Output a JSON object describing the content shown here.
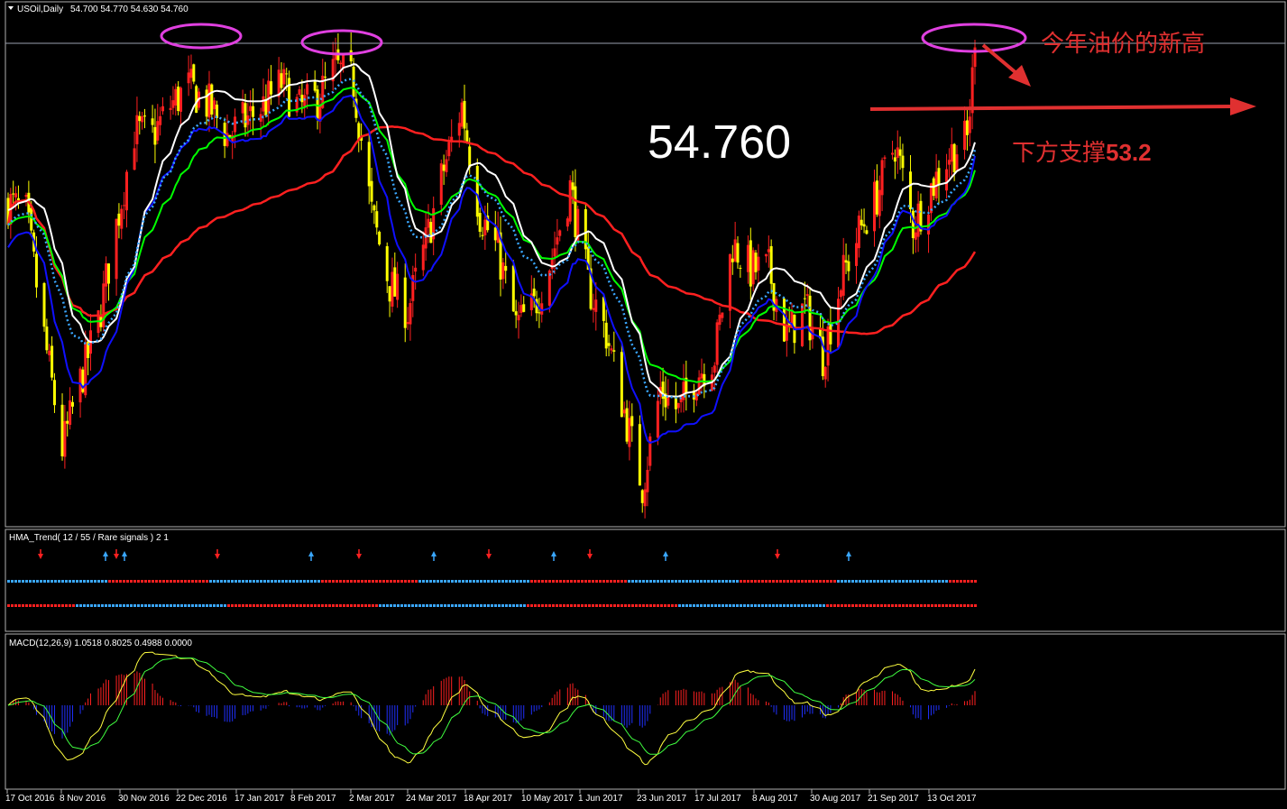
{
  "header": {
    "symbol": "USOil,Daily",
    "ohlc": "54.700 54.770 54.630 54.760"
  },
  "annotations": {
    "price_big": "54.760",
    "new_high": "今年油价的新高",
    "support_prefix": "下方支撑",
    "support_value": "53.2"
  },
  "hma_panel": {
    "title": "HMA_Trend( 12 / 55 / Rare signals ) 2 1",
    "signals": [
      {
        "x": "Oct 2016",
        "dir": "down"
      },
      {
        "x": "Nov 2016 a",
        "dir": "up"
      },
      {
        "x": "Nov 2016 b",
        "dir": "down"
      },
      {
        "x": "Nov 2016 c",
        "dir": "up"
      },
      {
        "x": "Dec 2016",
        "dir": "down"
      },
      {
        "x": "Feb 2017 a",
        "dir": "up"
      },
      {
        "x": "Feb 2017 b",
        "dir": "down"
      },
      {
        "x": "Mar 2017",
        "dir": "up"
      },
      {
        "x": "Apr 2017",
        "dir": "down"
      },
      {
        "x": "May 2017 a",
        "dir": "up"
      },
      {
        "x": "May 2017 b",
        "dir": "down"
      },
      {
        "x": "Jun 2017",
        "dir": "up"
      },
      {
        "x": "Aug 2017",
        "dir": "down"
      },
      {
        "x": "Aug 2017 b",
        "dir": "up"
      }
    ]
  },
  "macd_panel": {
    "title": "MACD(12,26,9) 1.0518 0.8025 0.4988 0.0000"
  },
  "colors": {
    "bull_candle": "#ff2020",
    "bear_candle": "#ffff00",
    "fast_ma": "#00ff00",
    "slow_ma": "#ff2020",
    "hma_blue": "#1010ff",
    "hma_white": "#ffffff",
    "dotted_ma": "#3aa7ff",
    "annotation_red": "#e03030",
    "ellipse": "#e040e0"
  },
  "chart_data": {
    "type": "candlestick",
    "symbol": "USOil",
    "timeframe": "Daily",
    "resistance_level": 54.76,
    "support_level": 53.2,
    "x_labels": [
      "17 Oct 2016",
      "8 Nov 2016",
      "30 Nov 2016",
      "22 Dec 2016",
      "17 Jan 2017",
      "8 Feb 2017",
      "2 Mar 2017",
      "24 Mar 2017",
      "18 Apr 2017",
      "10 May 2017",
      "1 Jun 2017",
      "23 Jun 2017",
      "17 Jul 2017",
      "8 Aug 2017",
      "30 Aug 2017",
      "21 Sep 2017",
      "13 Oct 2017"
    ],
    "close_path": [
      {
        "date": "2016-10-17",
        "close": 50.6
      },
      {
        "date": "2016-10-24",
        "close": 50.3
      },
      {
        "date": "2016-10-31",
        "close": 47.0
      },
      {
        "date": "2016-11-07",
        "close": 44.0
      },
      {
        "date": "2016-11-14",
        "close": 45.8
      },
      {
        "date": "2016-11-21",
        "close": 47.4
      },
      {
        "date": "2016-11-28",
        "close": 50.0
      },
      {
        "date": "2016-12-05",
        "close": 52.5
      },
      {
        "date": "2016-12-12",
        "close": 52.4
      },
      {
        "date": "2016-12-19",
        "close": 53.2
      },
      {
        "date": "2016-12-26",
        "close": 53.7
      },
      {
        "date": "2017-01-03",
        "close": 53.2
      },
      {
        "date": "2017-01-10",
        "close": 52.4
      },
      {
        "date": "2017-01-17",
        "close": 52.8
      },
      {
        "date": "2017-01-24",
        "close": 53.2
      },
      {
        "date": "2017-01-31",
        "close": 53.8
      },
      {
        "date": "2017-02-07",
        "close": 53.1
      },
      {
        "date": "2017-02-14",
        "close": 53.4
      },
      {
        "date": "2017-02-21",
        "close": 54.2
      },
      {
        "date": "2017-02-28",
        "close": 53.8
      },
      {
        "date": "2017-03-07",
        "close": 50.3
      },
      {
        "date": "2017-03-14",
        "close": 48.4
      },
      {
        "date": "2017-03-21",
        "close": 47.7
      },
      {
        "date": "2017-03-28",
        "close": 49.5
      },
      {
        "date": "2017-04-04",
        "close": 51.5
      },
      {
        "date": "2017-04-11",
        "close": 53.2
      },
      {
        "date": "2017-04-18",
        "close": 50.3
      },
      {
        "date": "2017-04-25",
        "close": 49.3
      },
      {
        "date": "2017-05-02",
        "close": 47.3
      },
      {
        "date": "2017-05-09",
        "close": 47.8
      },
      {
        "date": "2017-05-16",
        "close": 49.2
      },
      {
        "date": "2017-05-23",
        "close": 51.0
      },
      {
        "date": "2017-05-30",
        "close": 48.4
      },
      {
        "date": "2017-06-06",
        "close": 47.1
      },
      {
        "date": "2017-06-13",
        "close": 45.0
      },
      {
        "date": "2017-06-20",
        "close": 43.0
      },
      {
        "date": "2017-06-27",
        "close": 45.6
      },
      {
        "date": "2017-07-04",
        "close": 45.0
      },
      {
        "date": "2017-07-11",
        "close": 46.0
      },
      {
        "date": "2017-07-18",
        "close": 46.5
      },
      {
        "date": "2017-07-25",
        "close": 49.5
      },
      {
        "date": "2017-08-01",
        "close": 48.8
      },
      {
        "date": "2017-08-08",
        "close": 48.8
      },
      {
        "date": "2017-08-15",
        "close": 47.0
      },
      {
        "date": "2017-08-22",
        "close": 47.8
      },
      {
        "date": "2017-08-29",
        "close": 46.5
      },
      {
        "date": "2017-09-05",
        "close": 48.5
      },
      {
        "date": "2017-09-12",
        "close": 49.8
      },
      {
        "date": "2017-09-19",
        "close": 50.8
      },
      {
        "date": "2017-09-26",
        "close": 52.2
      },
      {
        "date": "2017-10-03",
        "close": 50.0
      },
      {
        "date": "2017-10-10",
        "close": 51.0
      },
      {
        "date": "2017-10-17",
        "close": 51.9
      },
      {
        "date": "2017-10-24",
        "close": 52.3
      },
      {
        "date": "2017-10-27",
        "close": 54.76
      }
    ]
  }
}
